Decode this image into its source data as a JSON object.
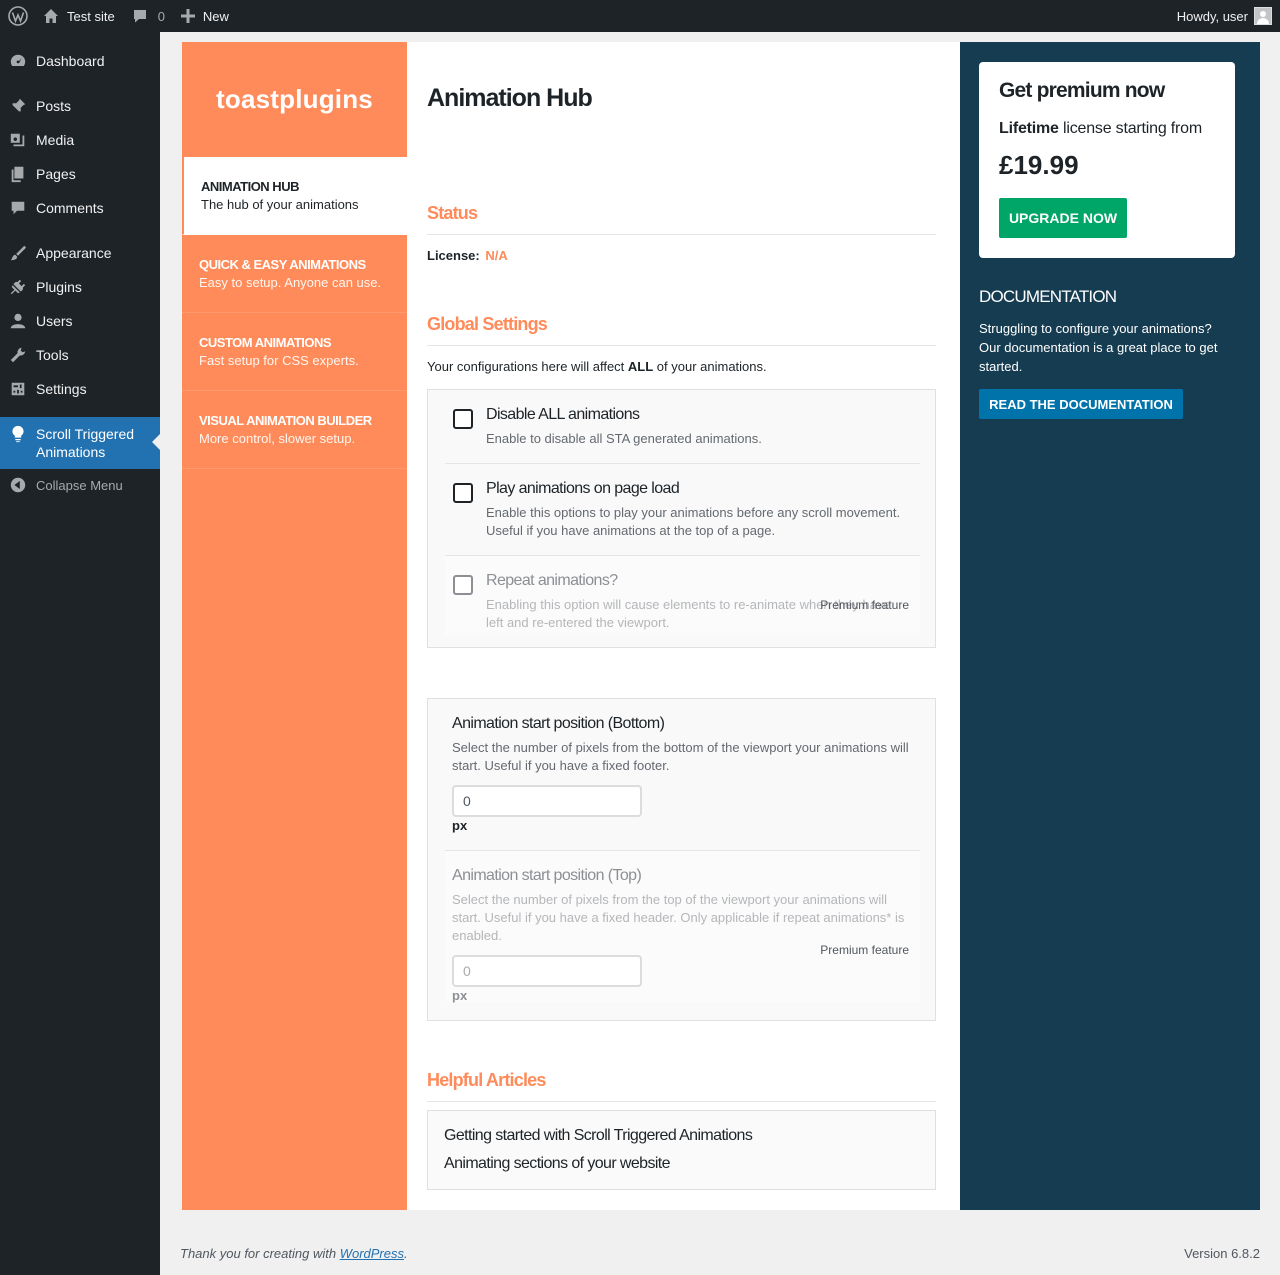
{
  "adminbar": {
    "site_name": "Test site",
    "comments_count": "0",
    "new_label": "New",
    "howdy": "Howdy, user"
  },
  "menu": {
    "items": [
      {
        "label": "Dashboard",
        "icon": "dashboard-icon"
      },
      {
        "label": "Posts",
        "icon": "pin-icon"
      },
      {
        "label": "Media",
        "icon": "media-icon"
      },
      {
        "label": "Pages",
        "icon": "pages-icon"
      },
      {
        "label": "Comments",
        "icon": "comment-icon"
      },
      {
        "label": "Appearance",
        "icon": "brush-icon"
      },
      {
        "label": "Plugins",
        "icon": "plug-icon"
      },
      {
        "label": "Users",
        "icon": "user-icon"
      },
      {
        "label": "Tools",
        "icon": "wrench-icon"
      },
      {
        "label": "Settings",
        "icon": "settings-icon"
      }
    ],
    "current_line1": "Scroll Triggered",
    "current_line2": "Animations",
    "collapse": "Collapse Menu"
  },
  "plugin_nav": {
    "logo": "toastplugins",
    "items": [
      {
        "title": "ANIMATION HUB",
        "sub": "The hub of your animations"
      },
      {
        "title": "QUICK & EASY ANIMATIONS",
        "sub": "Easy to setup. Anyone can use."
      },
      {
        "title": "CUSTOM ANIMATIONS",
        "sub": "Fast setup for CSS experts."
      },
      {
        "title": "VISUAL ANIMATION BUILDER",
        "sub": "More control, slower setup."
      }
    ]
  },
  "main": {
    "title": "Animation Hub",
    "status_heading": "Status",
    "license_label": "License:",
    "license_value": "N/A",
    "global_heading": "Global Settings",
    "global_desc_pre": "Your configurations here will affect ",
    "global_desc_bold": "ALL",
    "global_desc_post": " of your animations.",
    "options": [
      {
        "title": "Disable ALL animations",
        "desc": "Enable to disable all STA generated animations."
      },
      {
        "title": "Play animations on page load",
        "desc": "Enable this options to play your animations before any scroll movement. Useful if you have animations at the top of a page."
      },
      {
        "title": "Repeat animations?",
        "desc": "Enabling this option will cause elements to re-animate when they have left and re-entered the viewport."
      }
    ],
    "premium_label": "Premium feature",
    "bottom_title": "Animation start position (Bottom)",
    "bottom_desc": "Select the number of pixels from the bottom of the viewport your animations will start. Useful if you have a fixed footer.",
    "bottom_value": "0",
    "top_title": "Animation start position (Top)",
    "top_desc": "Select the number of pixels from the top of the viewport your animations will start. Useful if you have a fixed header. Only applicable if repeat animations* is enabled.",
    "top_value": "0",
    "px_unit": "px",
    "articles_heading": "Helpful Articles",
    "articles": [
      "Getting started with Scroll Triggered Animations",
      "Animating sections of your website"
    ]
  },
  "aside": {
    "promo_heading": "Get premium now",
    "lifetime_bold": "Lifetime",
    "lifetime_rest": " license starting from",
    "price": "£19.99",
    "upgrade_label": "UPGRADE NOW",
    "doc_heading": "DOCUMENTATION",
    "doc_text": "Struggling to configure your animations? Our documentation is a great place to get started.",
    "doc_button": "READ THE DOCUMENTATION"
  },
  "footer": {
    "thanks_pre": "Thank you for creating with ",
    "thanks_link": "WordPress",
    "thanks_post": ".",
    "version": "Version 6.8.2"
  },
  "colors": {
    "accent": "#ff8b5a",
    "aside_bg": "#163c51",
    "upgrade": "#00a568",
    "doc_button": "#0073aa",
    "wp_blue": "#2271b1"
  }
}
